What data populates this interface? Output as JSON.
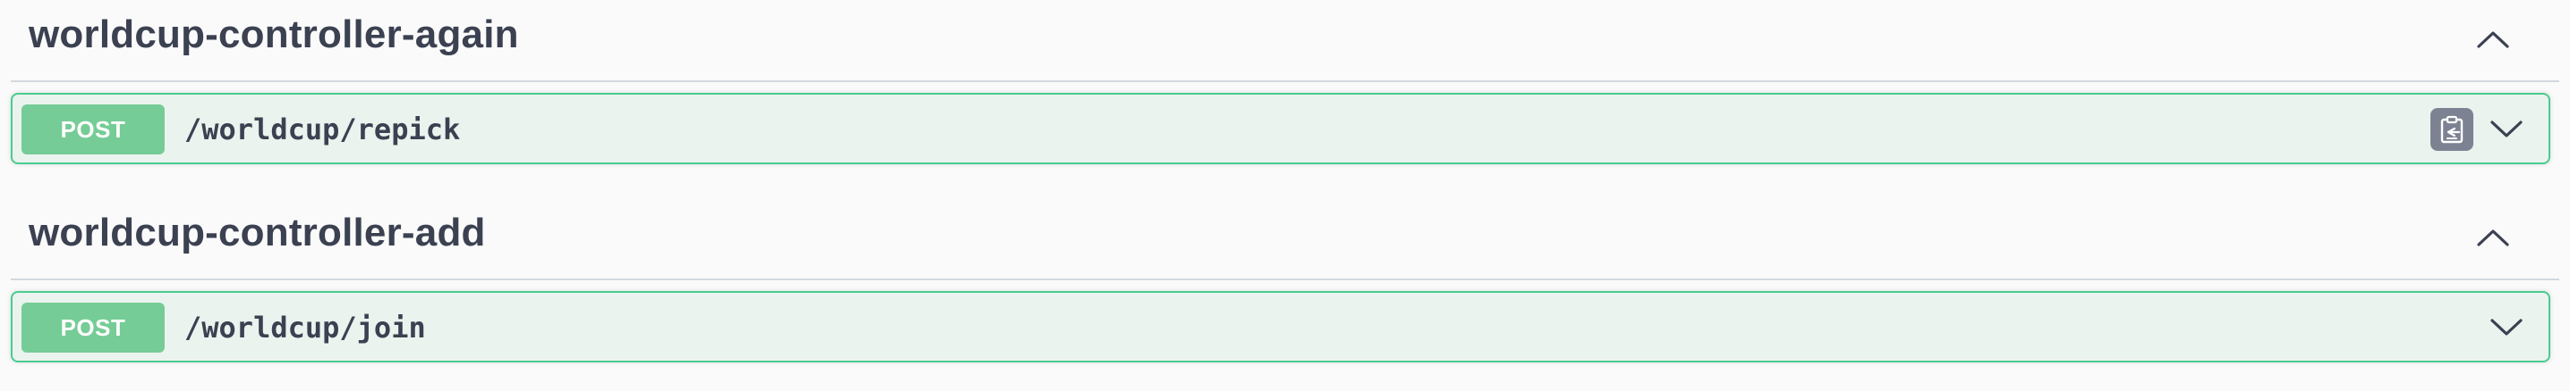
{
  "sections": [
    {
      "title": "worldcup-controller-again",
      "toggle_icon": "chevron-up-icon",
      "operation": {
        "method": "POST",
        "path": "/worldcup/repick",
        "copy_icon": "copy-to-clipboard-icon",
        "expand_icon": "chevron-down-icon"
      }
    },
    {
      "title": "worldcup-controller-add",
      "toggle_icon": "chevron-up-icon",
      "operation": {
        "method": "POST",
        "path": "/worldcup/join",
        "expand_icon": "chevron-down-icon"
      }
    }
  ],
  "colors": {
    "post_badge": "#75cc96",
    "post_border": "#49cc90",
    "post_background": "#ebf3ee",
    "copy_button": "#7d8293",
    "text": "#3b4151"
  }
}
